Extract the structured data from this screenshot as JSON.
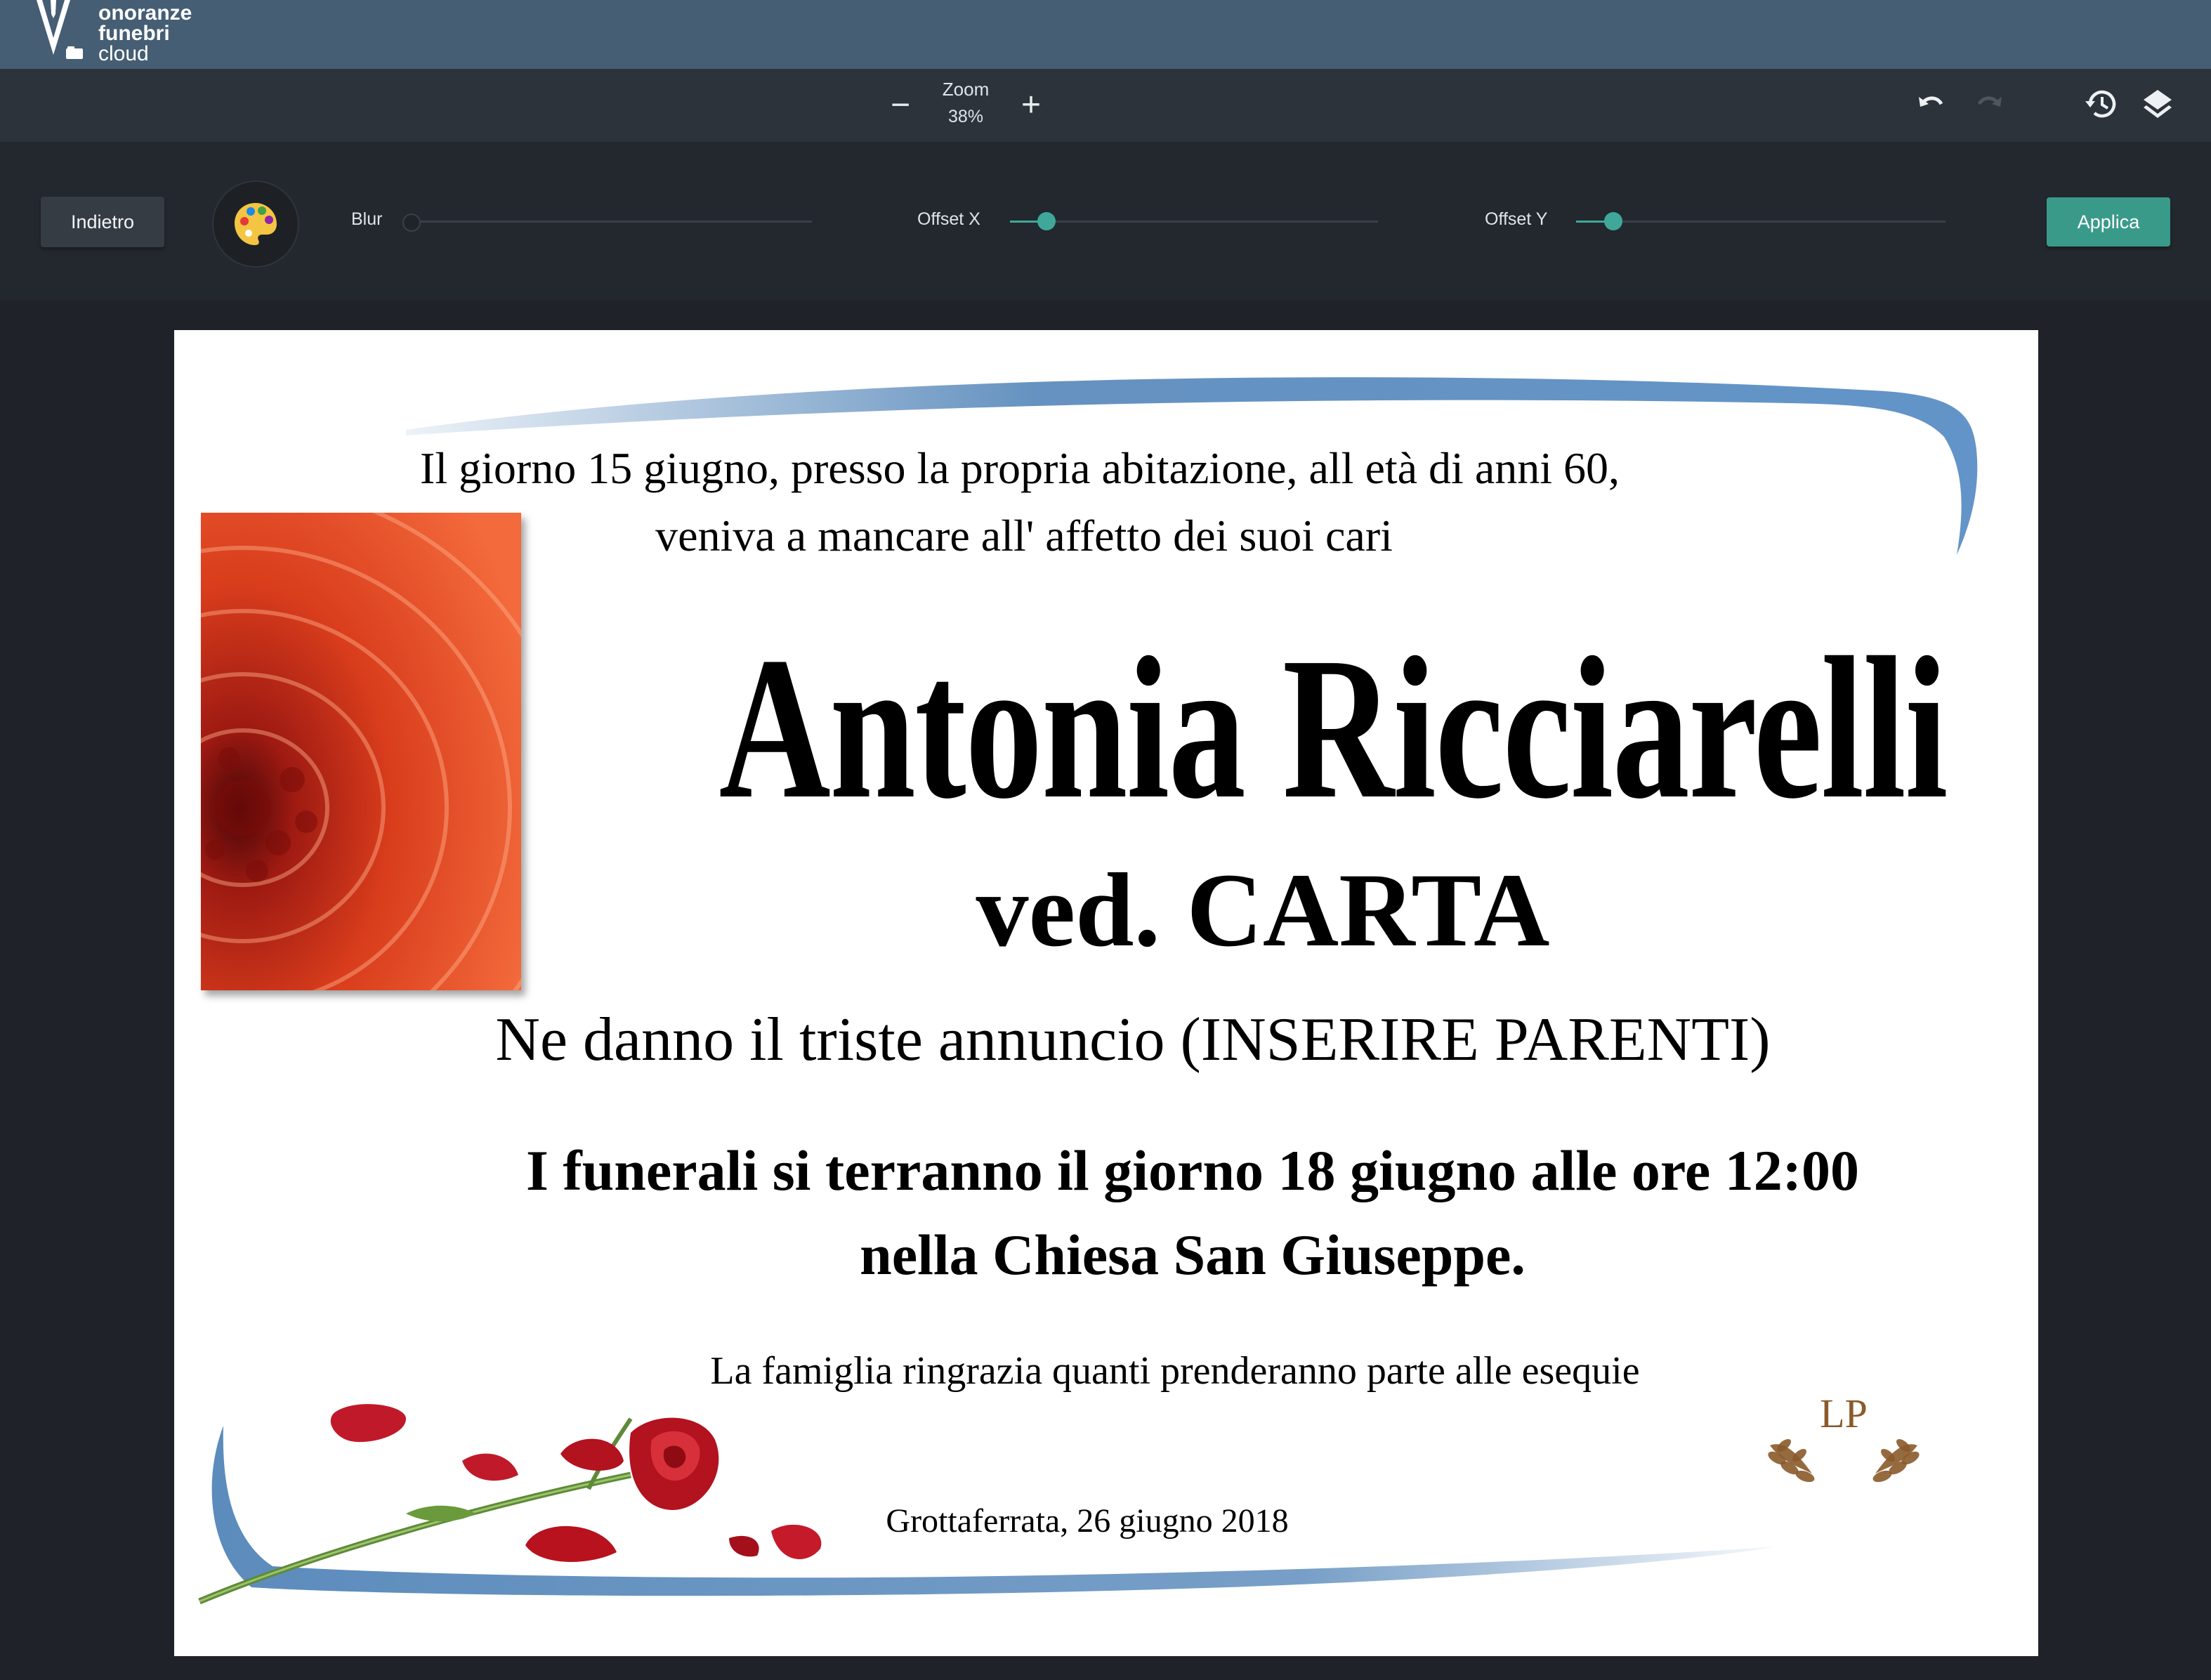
{
  "brand": {
    "line1": "onoranze",
    "line2": "funebri",
    "line3": "cloud",
    "color": "#455e74"
  },
  "toolbar": {
    "zoom_label": "Zoom",
    "zoom_value": "38%",
    "zoom_out_symbol": "−",
    "zoom_in_symbol": "+",
    "icons": [
      "undo-icon",
      "redo-icon",
      "history-icon",
      "layers-icon"
    ]
  },
  "filter": {
    "back_label": "Indietro",
    "apply_label": "Applica",
    "accent_color": "#3fa89a",
    "sliders": [
      {
        "label": "Blur",
        "value": 0
      },
      {
        "label": "Offset X",
        "value": 0.1
      },
      {
        "label": "Offset Y",
        "value": 0.1
      }
    ]
  },
  "document": {
    "intro_line1": "Il giorno 15 giugno, presso la propria abitazione, all età di anni 60,",
    "intro_line2": "veniva a mancare all' affetto dei suoi cari",
    "name": "Antonia Ricciarelli",
    "widow_of": "ved. CARTA",
    "announcement": "Ne danno il triste annuncio (INSERIRE PARENTI)",
    "funeral_line1": "I funerali si terranno il giorno 18 giugno alle ore 12:00",
    "funeral_line2": "nella Chiesa San Giuseppe.",
    "thanks": "La famiglia ringrazia quanti prenderanno parte alle esequie",
    "place_date": "Grottaferrata, 26 giugno 2018",
    "monogram": "LP"
  }
}
